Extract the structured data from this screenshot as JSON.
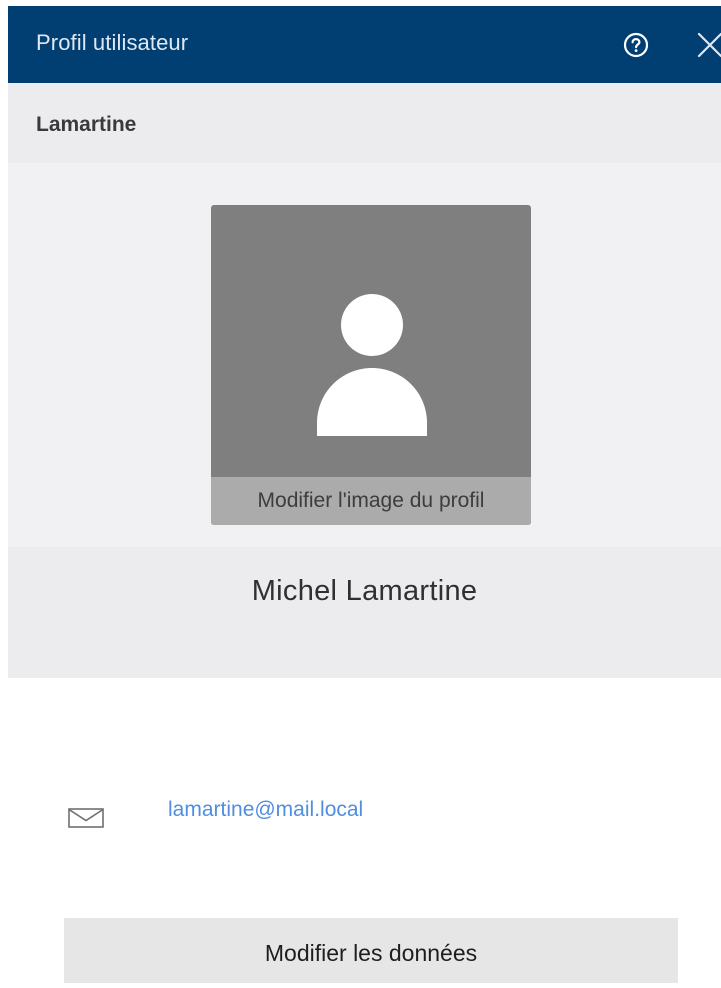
{
  "dialog": {
    "title": "Profil utilisateur",
    "help_icon": "help-circle-icon",
    "close_icon": "close-icon",
    "header_color": "#013f73"
  },
  "subheader": {
    "label": "Lamartine"
  },
  "profile": {
    "avatar_icon": "user-silhouette-icon",
    "change_picture_label": "Modifier l'image du profil",
    "full_name": "Michel Lamartine"
  },
  "contact": {
    "email_icon": "envelope-icon",
    "email": "lamartine@mail.local",
    "email_color": "#4f8ee0"
  },
  "actions": {
    "edit_label": "Modifier les données"
  }
}
